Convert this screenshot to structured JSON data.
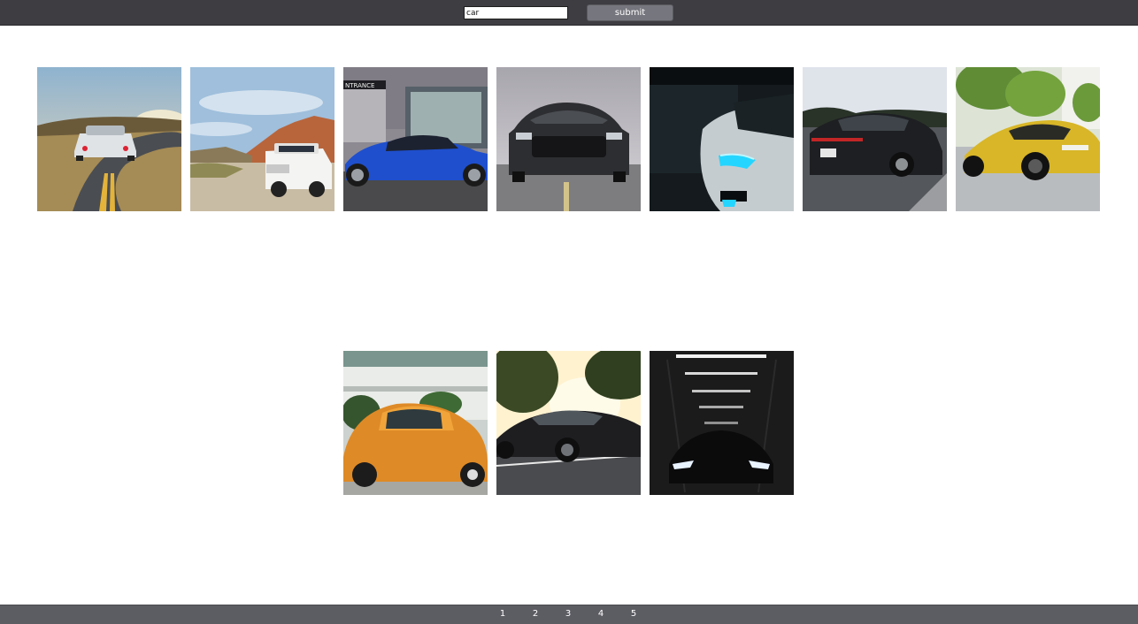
{
  "search": {
    "value": "car"
  },
  "toolbar": {
    "submit_label": "submit"
  },
  "results": [
    {
      "name": "result-image-white-sports-car-road"
    },
    {
      "name": "result-image-white-suv-desert"
    },
    {
      "name": "result-image-blue-coupe"
    },
    {
      "name": "result-image-gray-muscle-car"
    },
    {
      "name": "result-image-white-car-headlight"
    },
    {
      "name": "result-image-black-sports-car-rear"
    },
    {
      "name": "result-image-yellow-supercar"
    },
    {
      "name": "result-image-orange-beetle"
    },
    {
      "name": "result-image-black-mustang-sunset"
    },
    {
      "name": "result-image-dark-garage-car"
    }
  ],
  "pagination": {
    "pages": [
      "1",
      "2",
      "3",
      "4",
      "5"
    ]
  },
  "colors": {
    "topbar": "#3d3d42",
    "footer": "#5c5c63",
    "button": "#76767e"
  }
}
